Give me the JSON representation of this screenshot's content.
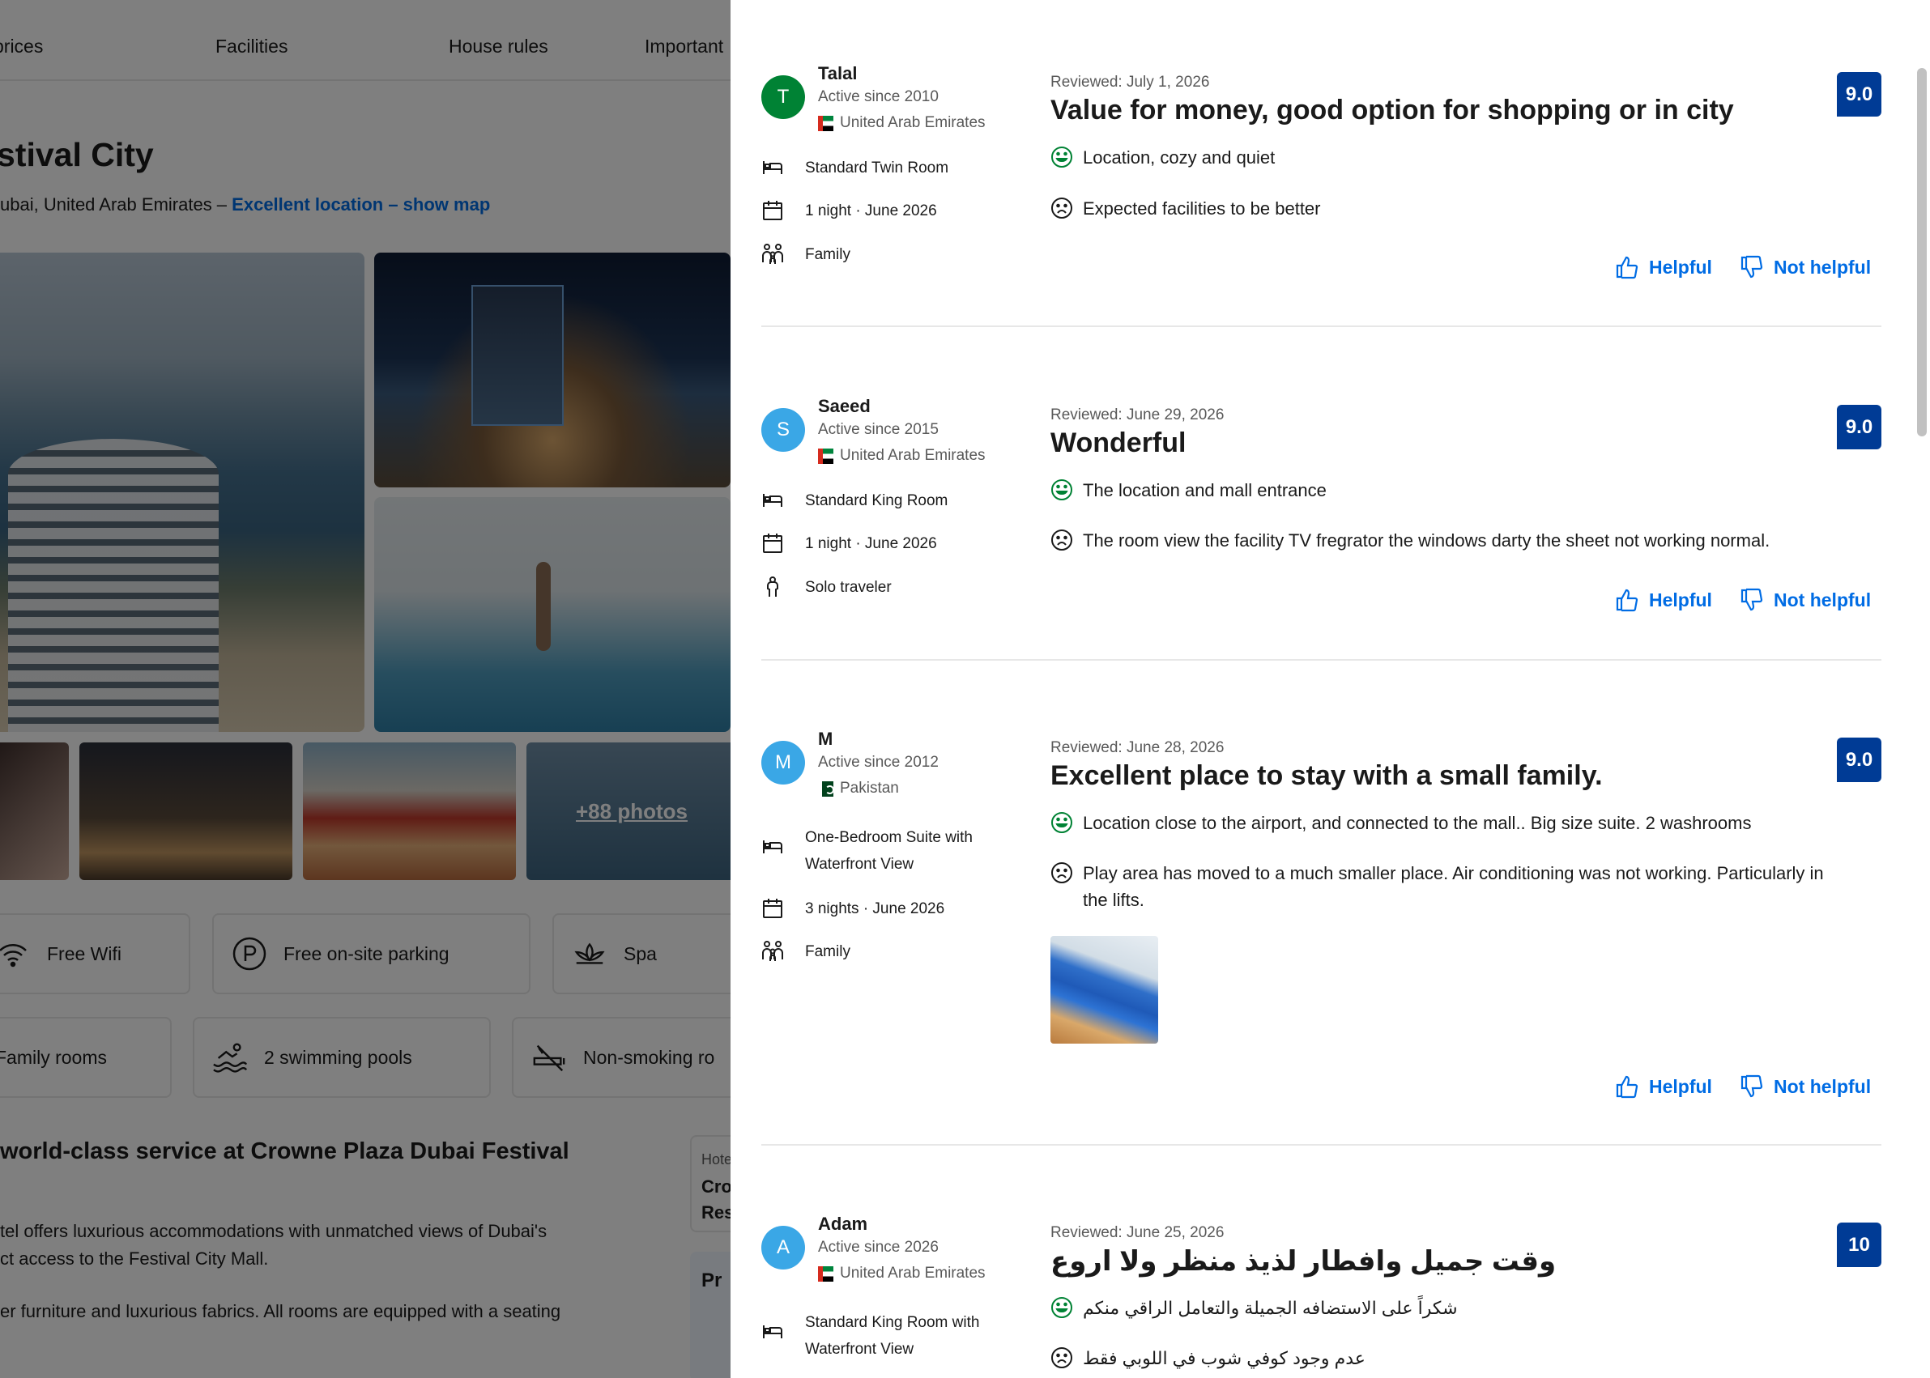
{
  "background": {
    "nav": [
      "prices",
      "Facilities",
      "House rules",
      "Important"
    ],
    "hotel_title": "stival City",
    "address_prefix": "ubai, United Arab Emirates –",
    "location_link": "Excellent location – show map",
    "more_photos": "+88 photos",
    "facilities_row1": [
      "Free Wifi",
      "Free on-site parking",
      "Spa"
    ],
    "facilities_row2": [
      "Family rooms",
      "2 swimming pools",
      "Non-smoking ro"
    ],
    "description_title": "world-class service at Crowne Plaza Dubai Festival",
    "description_p1_l1": "tel offers luxurious accommodations with unmatched views of Dubai's",
    "description_p1_l2": "ct access to the Festival City Mall.",
    "description_p2_l1": "er furniture and luxurious fabrics. All rooms are equipped with a seating",
    "side_box_label": "Hote",
    "side_box_text1": "Cro",
    "side_box_text2": "Res",
    "side_box2_text": "Pr"
  },
  "reviews": [
    {
      "initial": "T",
      "avatar_color": "#008234",
      "name": "Talal",
      "since": "Active since 2010",
      "country": "United Arab Emirates",
      "room": "Standard Twin Room",
      "stay": "1 night · June 2026",
      "traveler": "Family",
      "date": "Reviewed: July 1, 2026",
      "title": "Value for money, good option for shopping or in city",
      "positive": "Location, cozy and quiet",
      "negative": "Expected facilities to be better",
      "score": "9.0"
    },
    {
      "initial": "S",
      "avatar_color": "#3aa7e6",
      "name": "Saeed",
      "since": "Active since 2015",
      "country": "United Arab Emirates",
      "room": "Standard King Room",
      "stay": "1 night · June 2026",
      "traveler": "Solo traveler",
      "date": "Reviewed: June 29, 2026",
      "title": "Wonderful",
      "positive": "The location and mall entrance",
      "negative": "The room view the facility TV fregrator the windows darty the sheet not working normal.",
      "score": "9.0"
    },
    {
      "initial": "M",
      "avatar_color": "#3aa7e6",
      "name": "M",
      "since": "Active since 2012",
      "country": "Pakistan",
      "room_l1": "One-Bedroom Suite with",
      "room_l2": "Waterfront View",
      "stay": "3 nights · June 2026",
      "traveler": "Family",
      "date": "Reviewed: June 28, 2026",
      "title": "Excellent place to stay with a small family.",
      "positive": "Location close to the airport, and connected to the mall.. Big size suite. 2 washrooms",
      "negative_l1": "Play area has moved to a much smaller place. Air conditioning was not working. Particularly in",
      "negative_l2": "the lifts.",
      "score": "9.0"
    },
    {
      "initial": "A",
      "avatar_color": "#3aa7e6",
      "name": "Adam",
      "since": "Active since 2026",
      "country": "United Arab Emirates",
      "room_l1": "Standard King Room with",
      "room_l2": "Waterfront View",
      "date": "Reviewed: June 25, 2026",
      "title": "وقت جميل وافطار لذيذ منظر ولا اروع",
      "positive": "شكراً على الاستضافه الجميلة والتعامل الراقي منكم",
      "negative": "عدم وجود كوفي شوب في اللوبي فقط",
      "score": "10"
    }
  ],
  "feedback": {
    "helpful": "Helpful",
    "not_helpful": "Not helpful"
  },
  "colors": {
    "accent": "#006ce4",
    "score_bg": "#003b95",
    "positive": "#008234"
  }
}
